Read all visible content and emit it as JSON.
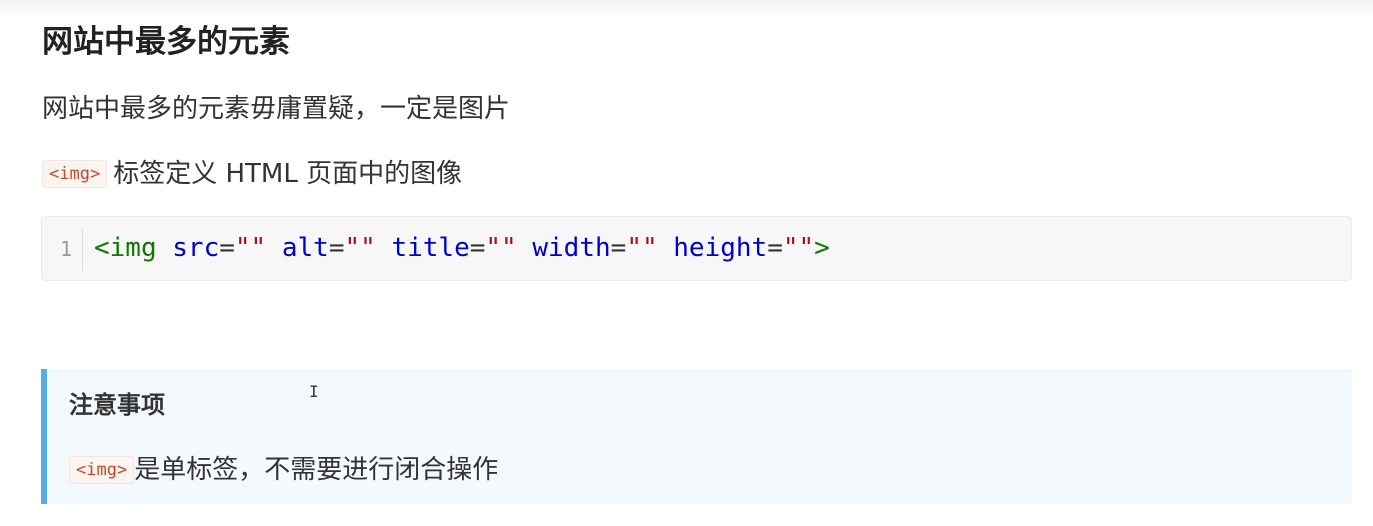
{
  "heading": "网站中最多的元素",
  "paragraph1": "网站中最多的元素毋庸置疑，一定是图片",
  "paragraph2": {
    "code": "<img>",
    "text": "标签定义 HTML 页面中的图像"
  },
  "code_block": {
    "line_number": "1",
    "tokens": {
      "open": "<img",
      "attr_src": "src",
      "attr_alt": "alt",
      "attr_title": "title",
      "attr_width": "width",
      "attr_height": "height",
      "equals": "=",
      "empty_string": "\"\"",
      "close": ">"
    }
  },
  "callout": {
    "title": "注意事项",
    "code": "<img>",
    "text": "是单标签，不需要进行闭合操作"
  },
  "colors": {
    "callout_border": "#5aaae6",
    "callout_bg": "#f4f9fd",
    "inline_code": "#c7452c",
    "tag": "#117700",
    "attr": "#0000cc",
    "string": "#aa1111"
  }
}
